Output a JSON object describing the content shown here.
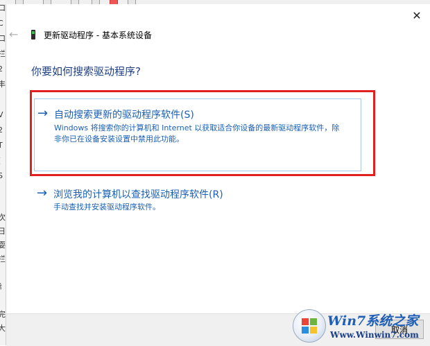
{
  "background_window": {
    "left_chars": [
      "口",
      "C",
      "口",
      "拦",
      "2",
      "丰",
      "I",
      "V",
      "2",
      "T",
      "(",
      "S",
      "I",
      "次",
      "日",
      "耍",
      "拦",
      "l",
      "纟",
      "l",
      "完",
      "大"
    ]
  },
  "dialog": {
    "title": "更新驱动程序 - 基本系统设备",
    "heading": "你要如何搜索驱动程序?",
    "options": [
      {
        "title": "自动搜索更新的驱动程序软件(S)",
        "description": "Windows 将搜索你的计算机和 Internet 以获取适合你设备的最新驱动程序软件，除非你已在设备安装设置中禁用此功能。"
      },
      {
        "title": "浏览我的计算机以查找驱动程序软件(R)",
        "description": "手动查找并安装驱动程序软件。"
      }
    ],
    "arrow_glyph": "→",
    "back_glyph": "←",
    "close_glyph": "✕",
    "cancel_label": "取消"
  },
  "watermark": {
    "brand": "Win7系统之家",
    "url": "Www.Winwin7.com"
  },
  "colors": {
    "link_blue": "#1a5fb4",
    "heading_blue": "#1e3f84",
    "highlight_red": "#e0201c"
  },
  "icons": {
    "back": "back-arrow-icon",
    "device": "device-icon",
    "close": "close-icon",
    "option_arrow": "arrow-right-icon"
  }
}
